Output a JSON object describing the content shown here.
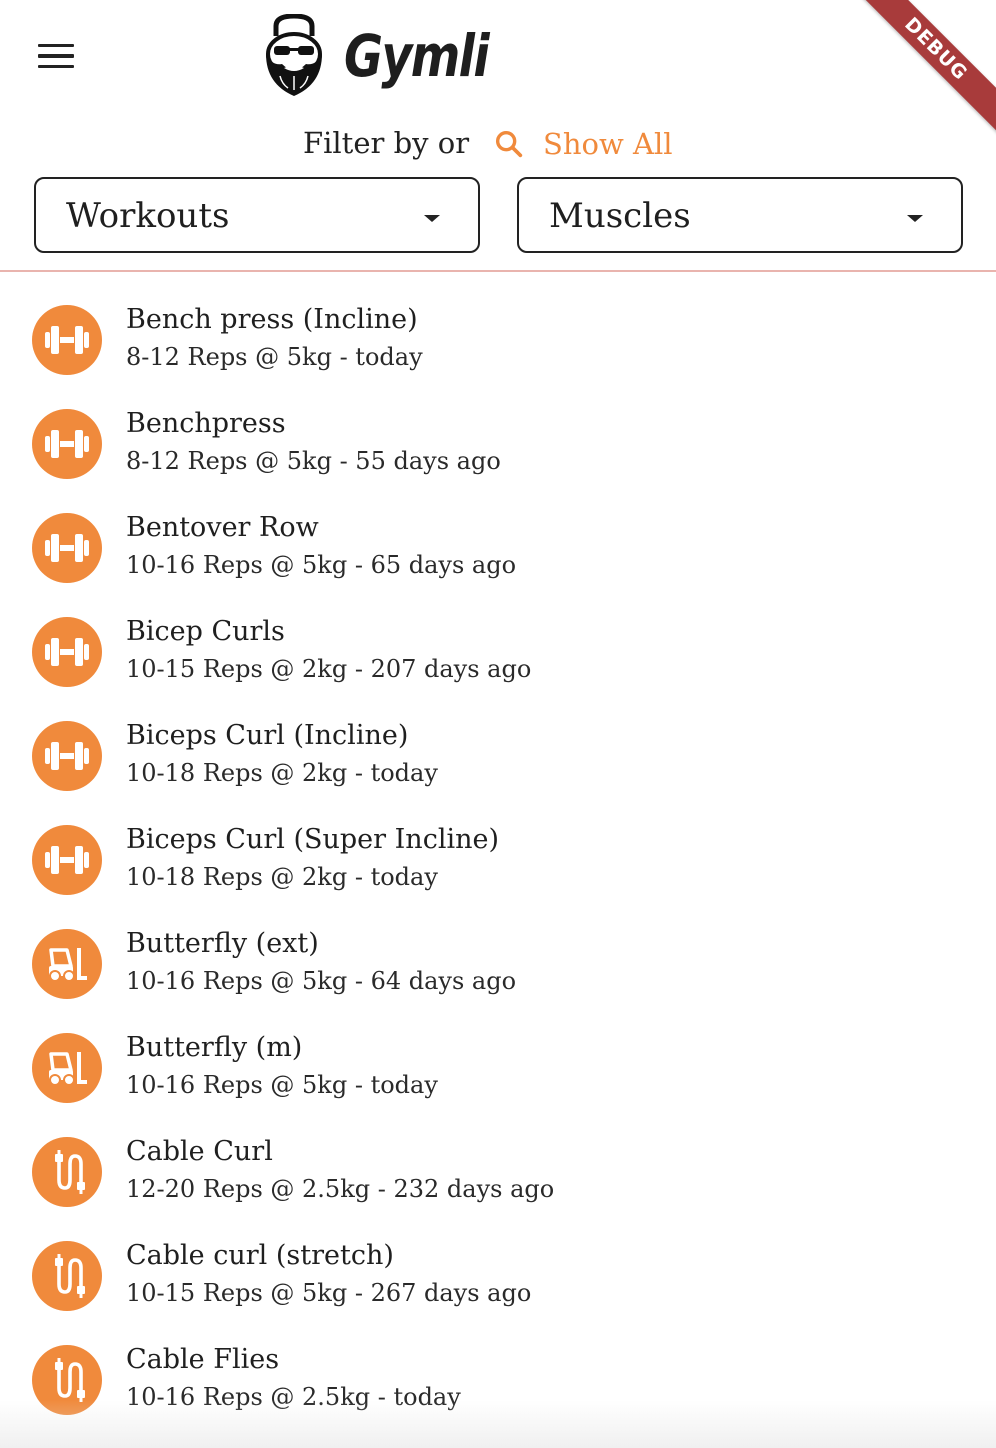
{
  "app": {
    "title": "Gymli",
    "debug_banner": "DEBUG",
    "accent_color": "#f08a3c"
  },
  "filter": {
    "label": "Filter by or",
    "show_all_label": "Show All",
    "show_all_icon": "search-icon"
  },
  "dropdowns": {
    "workouts": {
      "label": "Workouts"
    },
    "muscles": {
      "label": "Muscles"
    }
  },
  "exercises": [
    {
      "name": "Bench press (Incline)",
      "detail": "8-12 Reps @ 5kg - today",
      "icon": "dumbbell-icon"
    },
    {
      "name": "Benchpress",
      "detail": "8-12 Reps @ 5kg - 55 days ago",
      "icon": "dumbbell-icon"
    },
    {
      "name": "Bentover Row",
      "detail": "10-16 Reps @ 5kg - 65 days ago",
      "icon": "dumbbell-icon"
    },
    {
      "name": "Bicep Curls",
      "detail": "10-15 Reps @ 2kg - 207 days ago",
      "icon": "dumbbell-icon"
    },
    {
      "name": "Biceps Curl (Incline)",
      "detail": "10-18 Reps @ 2kg - today",
      "icon": "dumbbell-icon"
    },
    {
      "name": "Biceps Curl (Super Incline)",
      "detail": "10-18 Reps @ 2kg - today",
      "icon": "dumbbell-icon"
    },
    {
      "name": "Butterfly (ext)",
      "detail": "10-16 Reps @ 5kg - 64 days ago",
      "icon": "machine-icon"
    },
    {
      "name": "Butterfly (m)",
      "detail": "10-16 Reps @ 5kg - today",
      "icon": "machine-icon"
    },
    {
      "name": "Cable Curl",
      "detail": "12-20 Reps @ 2.5kg - 232 days ago",
      "icon": "cable-icon"
    },
    {
      "name": "Cable curl (stretch)",
      "detail": "10-15 Reps @ 5kg - 267 days ago",
      "icon": "cable-icon"
    },
    {
      "name": "Cable Flies",
      "detail": "10-16 Reps @ 2.5kg - today",
      "icon": "cable-icon"
    }
  ]
}
